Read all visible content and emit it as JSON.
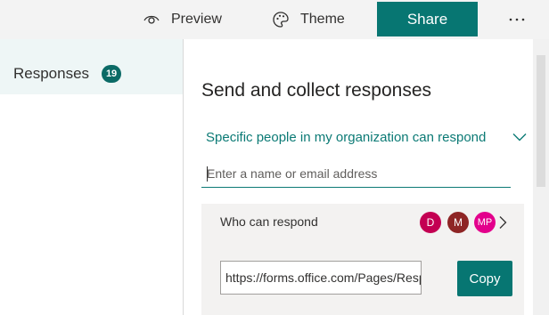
{
  "toolbar": {
    "preview_label": "Preview",
    "preview_icon": "eye-icon",
    "theme_label": "Theme",
    "theme_icon": "palette-icon",
    "share_label": "Share",
    "more_label": "···",
    "accent_color": "#077672"
  },
  "sidebar": {
    "responses_label": "Responses",
    "responses_count": "19"
  },
  "share_panel": {
    "title": "Send and collect responses",
    "audience_option": "Specific people in my organization can respond",
    "audience_icon": "chevron-down-icon",
    "email_placeholder": "Enter a name or email address",
    "email_value": "",
    "who_can_respond_label": "Who can respond",
    "respondents": [
      {
        "initials": "D",
        "color": "#c30052"
      },
      {
        "initials": "M",
        "color": "#8e2525"
      },
      {
        "initials": "MP",
        "color": "#e3008c"
      }
    ],
    "link_url": "https://forms.office.com/Pages/ResponsePage.aspx",
    "copy_label": "Copy"
  }
}
